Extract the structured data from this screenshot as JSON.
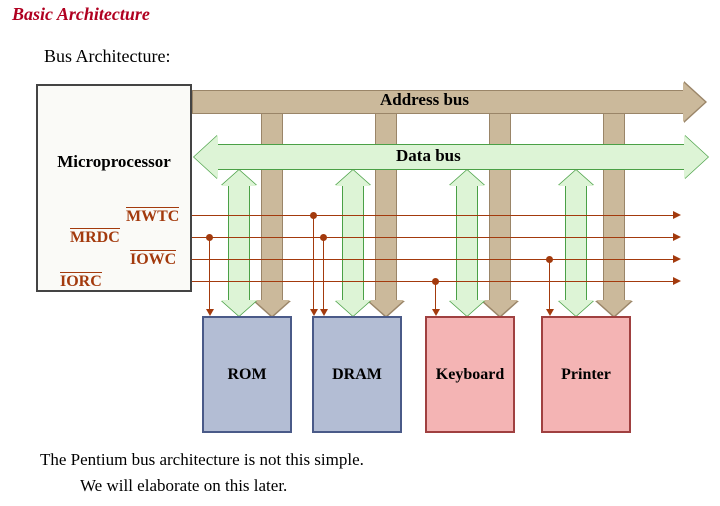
{
  "title": "Basic Architecture",
  "subtitle": "Bus Architecture:",
  "micro_label": "Microprocessor",
  "signals": {
    "mwtc": "MWTC",
    "mrdc": "MRDC",
    "iowc": "IOWC",
    "iorc": "IORC"
  },
  "buses": {
    "address": "Address bus",
    "data": "Data bus"
  },
  "devices": {
    "rom": "ROM",
    "dram": "DRAM",
    "keyboard": "Keyboard",
    "printer": "Printer"
  },
  "footer": {
    "line1": "The Pentium bus architecture is not this simple.",
    "line2": "We will elaborate on this later."
  }
}
